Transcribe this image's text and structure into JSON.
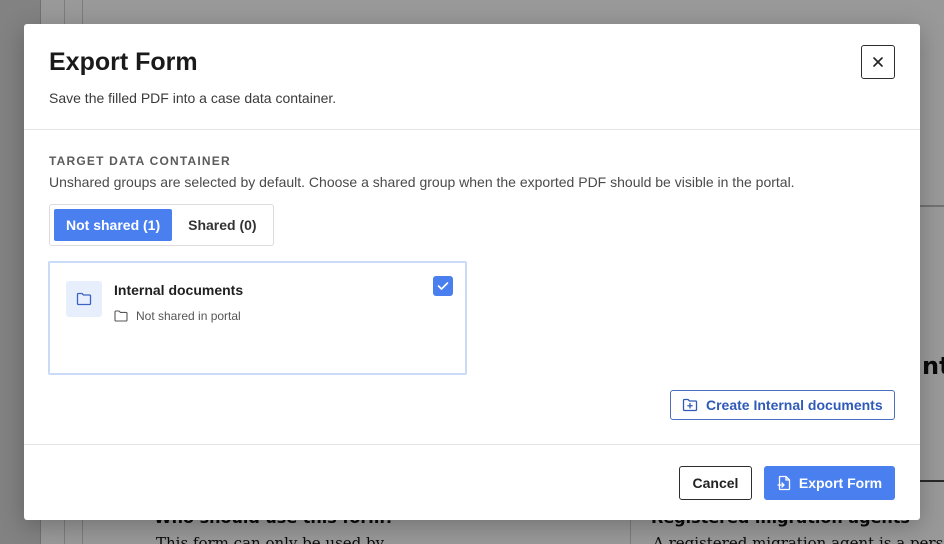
{
  "background": {
    "left_heading": "Who should use this form?",
    "left_text": "This form can only be used by",
    "right_heading": "Registered migration agents",
    "right_text": "A registered migration agent is a person",
    "side_text": "nt,"
  },
  "modal": {
    "title": "Export Form",
    "subtitle": "Save the filled PDF into a case data container.",
    "close_icon": "close-icon",
    "section_label": "TARGET DATA CONTAINER",
    "section_description": "Unshared groups are selected by default. Choose a shared group when the exported PDF should be visible in the portal.",
    "tabs": [
      {
        "label": "Not shared (1)",
        "active": true
      },
      {
        "label": "Shared (0)",
        "active": false
      }
    ],
    "containers": [
      {
        "title": "Internal documents",
        "status": "Not shared in portal",
        "icon": "folder-icon",
        "selected": true
      }
    ],
    "create_button_label": "Create Internal documents",
    "cancel_label": "Cancel",
    "export_label": "Export Form"
  },
  "colors": {
    "accent": "#4a7ff0",
    "accent_dark": "#2f5ab8",
    "card_border": "#c9dbf6"
  }
}
